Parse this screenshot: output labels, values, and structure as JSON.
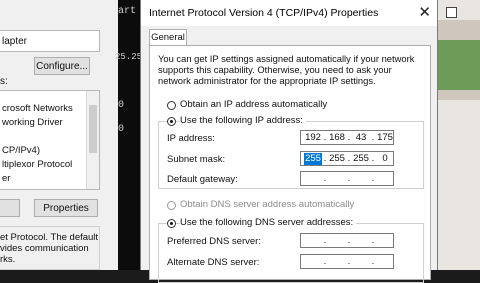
{
  "background_window": {
    "adapter_text": "lapter",
    "configure_label": "Configure...",
    "items_label": "s:",
    "items": [
      "crosoft Networks",
      "working Driver",
      "",
      "CP/IPv4)",
      "ltiplexor Protocol",
      "er"
    ],
    "properties_label": "Properties",
    "description": "et Protocol. The default\nvides communication\nrks."
  },
  "terminal": {
    "lines": [
      "art",
      "25.25",
      "0",
      "0"
    ]
  },
  "dialog": {
    "title": "Internet Protocol Version 4 (TCP/IPv4) Properties",
    "close_glyph": "✕",
    "tab_label": "General",
    "intro_text": "You can get IP settings assigned automatically if your network supports this capability. Otherwise, you need to ask your network administrator for the appropriate IP settings.",
    "ip_section": {
      "auto_label": "Obtain an IP address automatically",
      "manual_label": "Use the following IP address:",
      "selected": "manual",
      "ip_address_label": "IP address:",
      "ip_address": [
        "192",
        "168",
        "43",
        "175"
      ],
      "subnet_label": "Subnet mask:",
      "subnet_mask": [
        "255",
        "255",
        "255",
        "0"
      ],
      "subnet_selected_octet": 0,
      "gateway_label": "Default gateway:",
      "gateway": [
        "",
        "",
        "",
        ""
      ]
    },
    "dns_section": {
      "auto_label": "Obtain DNS server address automatically",
      "manual_label": "Use the following DNS server addresses:",
      "selected": "manual",
      "preferred_label": "Preferred DNS server:",
      "preferred": [
        "",
        "",
        "",
        ""
      ],
      "alternate_label": "Alternate DNS server:",
      "alternate": [
        "",
        "",
        "",
        ""
      ]
    }
  },
  "colors": {
    "selection": "#0078d7",
    "dialog_bg": "#f0f0f0",
    "terminal_bg": "#0c0c0c"
  }
}
